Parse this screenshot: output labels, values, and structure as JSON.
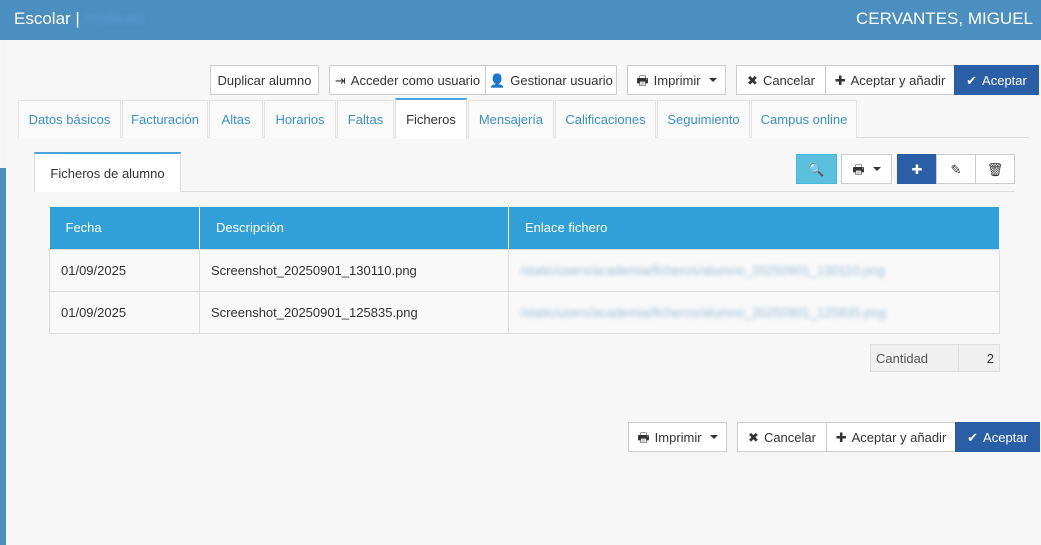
{
  "header": {
    "app_name": "Escolar |",
    "app_sub": "Instituto",
    "user_name": "CERVANTES, MIGUEL"
  },
  "toolbar_top": {
    "duplicate": "Duplicar alumno",
    "access_as_user": "Acceder como usuario",
    "manage_user": "Gestionar usuario",
    "print": "Imprimir",
    "cancel": "Cancelar",
    "accept_add": "Aceptar y añadir",
    "accept": "Aceptar"
  },
  "tabs": [
    "Datos básicos",
    "Facturación",
    "Altas",
    "Horarios",
    "Faltas",
    "Ficheros",
    "Mensajería",
    "Calificaciones",
    "Seguimiento",
    "Campus online"
  ],
  "active_tab": "Ficheros",
  "subtab": "Ficheros de alumno",
  "table": {
    "headers": [
      "Fecha",
      "Descripción",
      "Enlace fichero"
    ],
    "rows": [
      [
        "01/09/2025",
        "Screenshot_20250901_130110.png",
        "/static/users/academia/ficheros/alumno_20250901_130110.png"
      ],
      [
        "01/09/2025",
        "Screenshot_20250901_125835.png",
        "/static/users/academia/ficheros/alumno_20250901_125835.png"
      ]
    ]
  },
  "count": {
    "label": "Cantidad",
    "value": "2"
  },
  "toolbar_bottom": {
    "print": "Imprimir",
    "cancel": "Cancelar",
    "accept_add": "Aceptar y añadir",
    "accept": "Aceptar"
  },
  "icons": {
    "print": "printer-icon",
    "cancel": "close-icon",
    "add": "plus-icon",
    "accept": "check-icon",
    "search": "search-icon",
    "edit": "pencil-icon",
    "delete": "trash-icon",
    "login": "login-icon",
    "user": "user-icon"
  },
  "colors": {
    "topbar": "#4a8fc0",
    "primary": "#2a5ea7",
    "table_header": "#319fd8",
    "info": "#5bc0de"
  }
}
